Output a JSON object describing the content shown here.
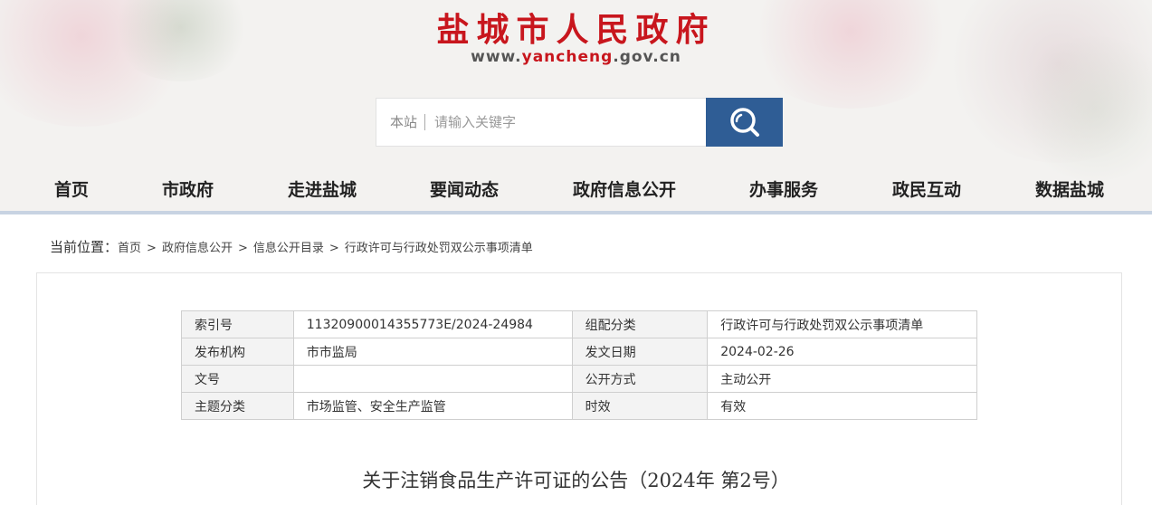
{
  "header": {
    "title": "盐城市人民政府",
    "url_prefix": "www.",
    "url_brand": "yancheng",
    "url_suffix": ".gov.cn"
  },
  "search": {
    "scope_label": "本站",
    "placeholder": "请输入关键字",
    "button_icon": "search-icon"
  },
  "nav": {
    "items": [
      {
        "label": "首页"
      },
      {
        "label": "市政府"
      },
      {
        "label": "走进盐城"
      },
      {
        "label": "要闻动态"
      },
      {
        "label": "政府信息公开"
      },
      {
        "label": "办事服务"
      },
      {
        "label": "政民互动"
      },
      {
        "label": "数据盐城"
      }
    ]
  },
  "breadcrumb": {
    "label": "当前位置：",
    "separator": ">",
    "items": [
      "首页",
      "政府信息公开",
      "信息公开目录",
      "行政许可与行政处罚双公示事项清单"
    ]
  },
  "meta_table": {
    "rows": [
      {
        "k1": "索引号",
        "v1": "11320900014355773E/2024-24984",
        "k2": "组配分类",
        "v2": "行政许可与行政处罚双公示事项清单"
      },
      {
        "k1": "发布机构",
        "v1": "市市监局",
        "k2": "发文日期",
        "v2": "2024-02-26"
      },
      {
        "k1": "文号",
        "v1": "",
        "k2": "公开方式",
        "v2": "主动公开"
      },
      {
        "k1": "主题分类",
        "v1": "市场监管、安全生产监管",
        "k2": "时效",
        "v2": "有效"
      }
    ]
  },
  "article": {
    "title": "关于注销食品生产许可证的公告（2024年 第2号）"
  },
  "colors": {
    "brand_red": "#c8161d",
    "search_button": "#2f5d95",
    "nav_underline": "#c8d3e2"
  }
}
